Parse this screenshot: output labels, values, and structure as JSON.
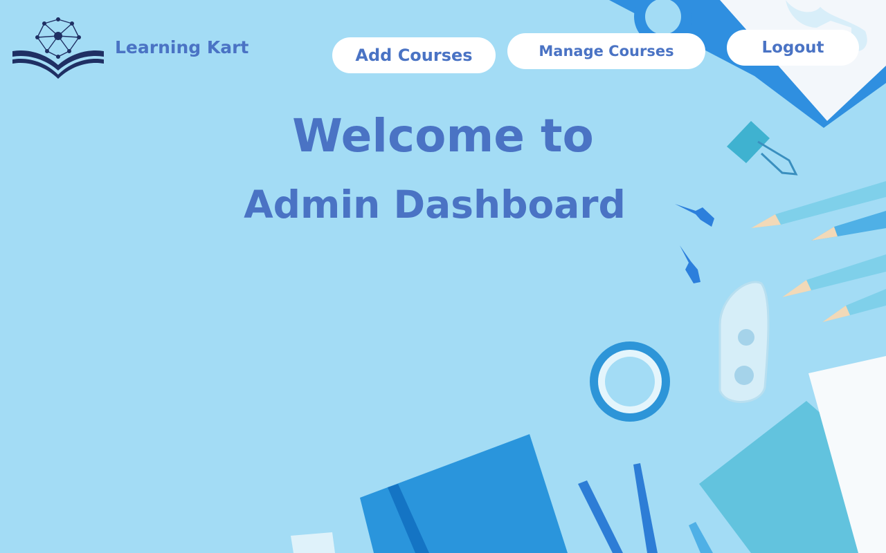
{
  "brand": {
    "name": "Learning Kart",
    "logo_icon": "book-network-icon"
  },
  "nav": {
    "add_courses": "Add Courses",
    "manage_courses": "Manage Courses",
    "logout": "Logout"
  },
  "hero": {
    "line1": "Welcome to",
    "line2": "Admin Dashboard"
  },
  "colors": {
    "background": "#a3dcf5",
    "accent_text": "#4a73c4",
    "logo_navy": "#1f2f63",
    "button_bg": "#ffffff"
  }
}
